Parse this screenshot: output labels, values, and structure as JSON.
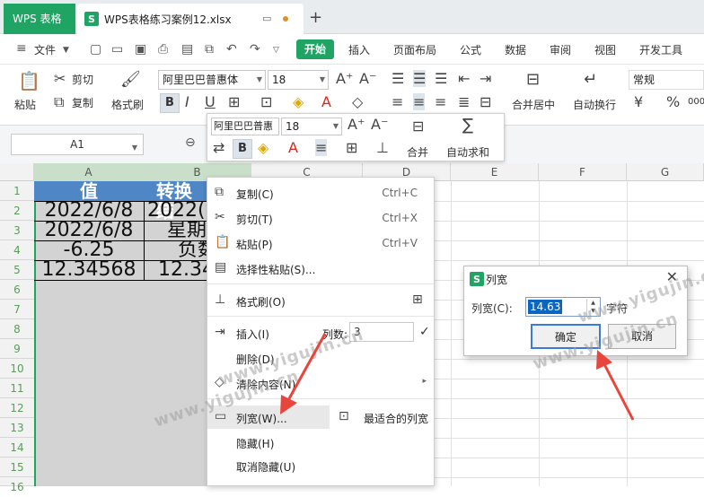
{
  "titlebar": {
    "app_label": "WPS 表格",
    "doc_name": "WPS表格练习案例12.xlsx",
    "new_tab": "+"
  },
  "menubar": {
    "file_label": "文件",
    "items": [
      "开始",
      "插入",
      "页面布局",
      "公式",
      "数据",
      "审阅",
      "视图",
      "开发工具"
    ]
  },
  "ribbon": {
    "paste": "粘贴",
    "cut": "剪切",
    "copy": "复制",
    "format_painter": "格式刷",
    "font_name": "阿里巴巴普惠体",
    "font_size": "18",
    "bold": "B",
    "merge": "合并居中",
    "wrap": "自动换行",
    "number_format": "常规",
    "currency": "¥",
    "percent": "%",
    "thousands": "000"
  },
  "namebox": {
    "value": "A1"
  },
  "minibar": {
    "font_name": "阿里巴巴普惠",
    "font_size": "18",
    "bold": "B",
    "merge": "合并",
    "autosum": "自动求和"
  },
  "grid": {
    "columns": [
      "A",
      "B",
      "C",
      "D",
      "E",
      "F",
      "G"
    ],
    "rows": [
      "1",
      "2",
      "3",
      "4",
      "5",
      "6",
      "7",
      "8",
      "9",
      "10",
      "11",
      "12",
      "13",
      "14",
      "15",
      "16"
    ],
    "colA": [
      "值",
      "2022/6/8",
      "2022/6/8",
      "-6.25",
      "12.34568"
    ],
    "colB": [
      "转换结",
      "2022(",
      "星期",
      "负数",
      "12.34"
    ]
  },
  "context_menu": {
    "copy": {
      "label": "复制(C)",
      "shortcut": "Ctrl+C"
    },
    "cut": {
      "label": "剪切(T)",
      "shortcut": "Ctrl+X"
    },
    "paste": {
      "label": "粘贴(P)",
      "shortcut": "Ctrl+V"
    },
    "paste_special": {
      "label": "选择性粘贴(S)..."
    },
    "format_painter": {
      "label": "格式刷(O)"
    },
    "insert": {
      "label": "插入(I)",
      "count_label": "列数:",
      "count_value": "3"
    },
    "delete": {
      "label": "删除(D)"
    },
    "clear": {
      "label": "清除内容(N)"
    },
    "column_width": {
      "label": "列宽(W)...",
      "best_fit": "最适合的列宽"
    },
    "hide": {
      "label": "隐藏(H)"
    },
    "unhide": {
      "label": "取消隐藏(U)"
    }
  },
  "dialog": {
    "title": "列宽",
    "field_label": "列宽(C):",
    "value": "14.63",
    "unit": "字符",
    "ok": "确定",
    "cancel": "取消"
  },
  "watermark": "www.yigujin.cn",
  "colors": {
    "accent": "#1fa464",
    "header_fill": "#4f86c6",
    "arrow": "#e8453c"
  }
}
